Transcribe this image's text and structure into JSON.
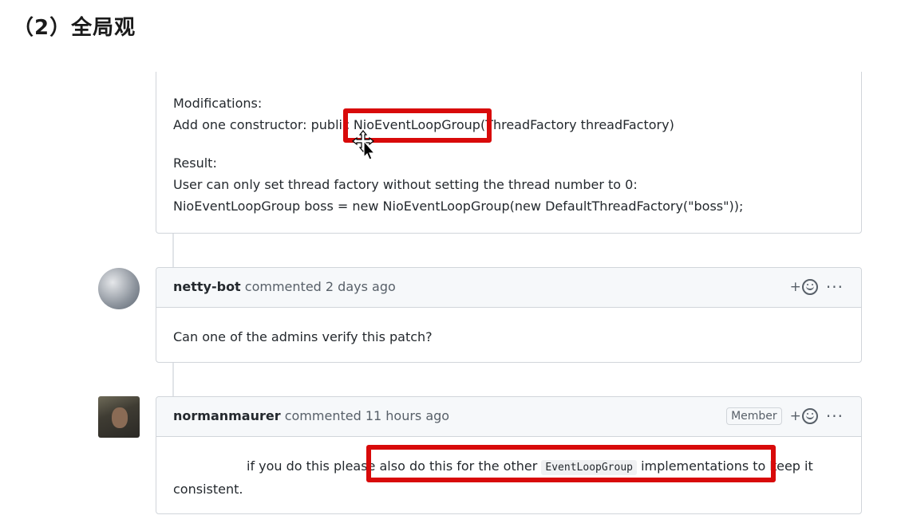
{
  "slide": {
    "heading": "（2）全局观"
  },
  "pr_description": {
    "modifications_label": "Modifications:",
    "modifications_text": "Add one constructor: public NioEventLoopGroup(ThreadFactory threadFactory)",
    "result_label": "Result:",
    "result_text": "User can only set thread factory without setting the thread number to 0:",
    "result_code": "NioEventLoopGroup boss = new NioEventLoopGroup(new DefaultThreadFactory(\"boss\"));"
  },
  "comments": [
    {
      "author": "netty-bot",
      "meta": "commented 2 days ago",
      "badge": "",
      "body": "Can one of the admins verify this patch?",
      "reaction_label": "+",
      "more_label": "···"
    },
    {
      "author": "normanmaurer",
      "meta": "commented 11 hours ago",
      "badge": "Member",
      "body_before": "if you do this please also do this for the other",
      "body_code": "EventLoopGroup",
      "body_after": "implementations to keep it",
      "body_line2": "consistent.",
      "reaction_label": "+",
      "more_label": "···"
    }
  ],
  "colors": {
    "highlight": "#d80a0a",
    "header_bg": "#f6f8fa",
    "border": "#d1d5da"
  },
  "icons": [
    "add-reaction-icon",
    "kebab-menu-icon",
    "move-cursor-icon"
  ]
}
